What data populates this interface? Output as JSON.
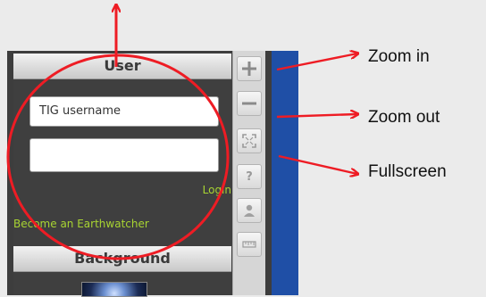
{
  "panel": {
    "header_title": "User",
    "username_placeholder": "TIG username",
    "password_value": "",
    "login_label": "Login",
    "become_label": "Become an Earthwatcher",
    "background_header": "Background"
  },
  "tools": [
    {
      "name": "zoom-in",
      "symbol": "+"
    },
    {
      "name": "zoom-out",
      "symbol": "—"
    },
    {
      "name": "fullscreen",
      "symbol": "⛶"
    },
    {
      "name": "help",
      "symbol": "?"
    },
    {
      "name": "person",
      "symbol": "☺"
    },
    {
      "name": "ruler",
      "symbol": "▭"
    }
  ],
  "annotations": {
    "zoom_in": "Zoom in",
    "zoom_out": "Zoom out",
    "fullscreen": "Fullscreen"
  },
  "colors": {
    "annotation_red": "#ee1c24",
    "link_green": "#a8d432",
    "map_blue": "#1f4fa6",
    "panel_dark": "#3f3f3f"
  }
}
